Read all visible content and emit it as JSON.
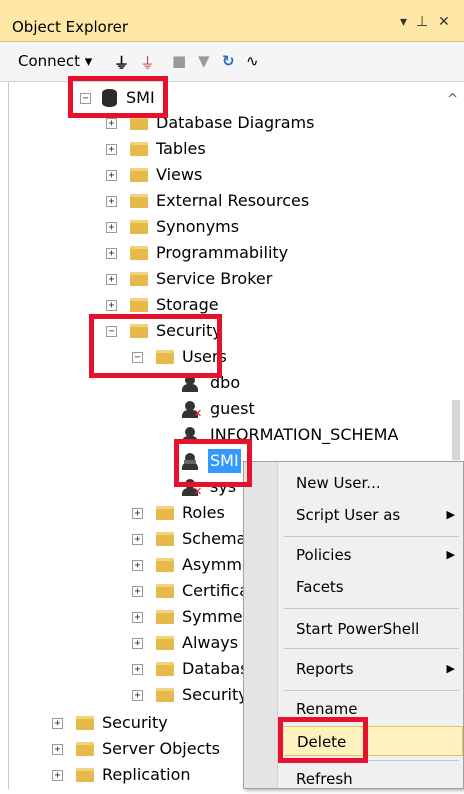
{
  "window": {
    "title": "Object Explorer",
    "pin_glyph": "▾ ⊥ ✕"
  },
  "toolbar": {
    "connect_label": "Connect ▾"
  },
  "tree": [
    {
      "label": "SMI",
      "icon": "database-icon",
      "expander": "−"
    },
    {
      "label": "Database Diagrams",
      "icon": "folder-icon",
      "expander": "+"
    },
    {
      "label": "Tables",
      "icon": "folder-icon",
      "expander": "+"
    },
    {
      "label": "Views",
      "icon": "folder-icon",
      "expander": "+"
    },
    {
      "label": "External Resources",
      "icon": "folder-icon",
      "expander": "+"
    },
    {
      "label": "Synonyms",
      "icon": "folder-icon",
      "expander": "+"
    },
    {
      "label": "Programmability",
      "icon": "folder-icon",
      "expander": "+"
    },
    {
      "label": "Service Broker",
      "icon": "folder-icon",
      "expander": "+"
    },
    {
      "label": "Storage",
      "icon": "folder-icon",
      "expander": "+"
    },
    {
      "label": "Security",
      "icon": "folder-icon",
      "expander": "−"
    },
    {
      "label": "Users",
      "icon": "folder-icon",
      "expander": "−"
    },
    {
      "label": "dbo",
      "icon": "user-icon"
    },
    {
      "label": "guest",
      "icon": "disabled-user-icon"
    },
    {
      "label": "INFORMATION_SCHEMA",
      "icon": "user-icon"
    },
    {
      "label": "SMI",
      "icon": "user-icon",
      "selected": true
    },
    {
      "label": "sys",
      "icon": "disabled-user-icon"
    },
    {
      "label": "Roles",
      "icon": "folder-icon",
      "expander": "+"
    },
    {
      "label": "Schemas",
      "icon": "folder-icon",
      "expander": "+"
    },
    {
      "label": "Asymmetric Keys",
      "icon": "folder-icon",
      "expander": "+"
    },
    {
      "label": "Certificates",
      "icon": "folder-icon",
      "expander": "+"
    },
    {
      "label": "Symmetric Keys",
      "icon": "folder-icon",
      "expander": "+"
    },
    {
      "label": "Always Encrypted Keys",
      "icon": "folder-icon",
      "expander": "+"
    },
    {
      "label": "Database Audit Specifications",
      "icon": "folder-icon",
      "expander": "+"
    },
    {
      "label": "Security Policies",
      "icon": "folder-icon",
      "expander": "+"
    },
    {
      "label": "Security",
      "icon": "folder-icon",
      "expander": "+"
    },
    {
      "label": "Server Objects",
      "icon": "folder-icon",
      "expander": "+"
    },
    {
      "label": "Replication",
      "icon": "folder-icon",
      "expander": "+"
    }
  ],
  "context_menu": [
    {
      "label": "New User...",
      "submenu": false
    },
    {
      "label": "Script User as",
      "submenu": true
    },
    {
      "label": "Policies",
      "submenu": true
    },
    {
      "label": "Facets",
      "submenu": false
    },
    {
      "label": "Start PowerShell",
      "submenu": false
    },
    {
      "label": "Reports",
      "submenu": true
    },
    {
      "label": "Rename",
      "submenu": false
    },
    {
      "label": "Delete",
      "submenu": false,
      "highlighted": true
    },
    {
      "label": "Refresh",
      "submenu": false
    }
  ],
  "colors": {
    "title_bar": "#ffe8a6",
    "selection": "#3399ff",
    "callout": "#e8112d",
    "menu_hover": "#fff2bf"
  }
}
